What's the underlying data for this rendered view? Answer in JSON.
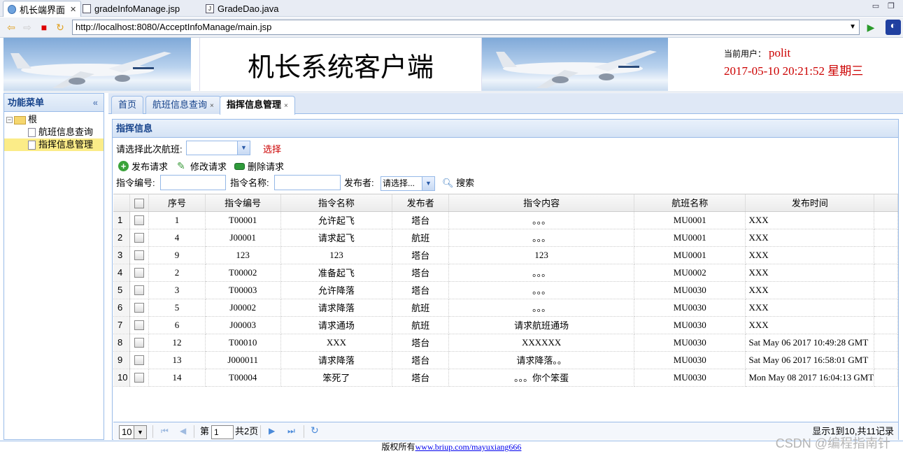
{
  "editor_tabs": [
    {
      "label": "机长端界面",
      "close": "✕"
    },
    {
      "label": "gradeInfoManage.jsp"
    },
    {
      "label": "GradeDao.java"
    }
  ],
  "address": {
    "url": "http://localhost:8080/AcceptInfoManage/main.jsp"
  },
  "header": {
    "system_title": "机长系统客户端",
    "user_label": "当前用户：",
    "user_name": "polit",
    "datetime": "2017-05-10 20:21:52 星期三"
  },
  "menu": {
    "title": "功能菜单",
    "collapse": "«",
    "root": "根",
    "items": [
      "航班信息查询",
      "指挥信息管理"
    ]
  },
  "tabs": [
    {
      "label": "首页"
    },
    {
      "label": "航班信息查询",
      "close": "×"
    },
    {
      "label": "指挥信息管理",
      "close": "×"
    }
  ],
  "panel": {
    "title": "指挥信息",
    "flight_label": "请选择此次航班:",
    "flight_value": "",
    "choose": "选择",
    "btn_publish": "发布请求",
    "btn_edit": "修改请求",
    "btn_delete": "删除请求",
    "code_label": "指令编号:",
    "name_label": "指令名称:",
    "publisher_label": "发布者:",
    "publisher_value": "请选择...",
    "search": "搜索"
  },
  "table": {
    "headers": [
      "序号",
      "指令编号",
      "指令名称",
      "发布者",
      "指令内容",
      "航班名称",
      "发布时间"
    ],
    "rows": [
      [
        "1",
        "1",
        "T00001",
        "允许起飞",
        "塔台",
        "。。。",
        "MU0001",
        "XXX"
      ],
      [
        "2",
        "4",
        "J00001",
        "请求起飞",
        "航班",
        "。。。",
        "MU0001",
        "XXX"
      ],
      [
        "3",
        "9",
        "123",
        "123",
        "塔台",
        "123",
        "MU0001",
        "XXX"
      ],
      [
        "4",
        "2",
        "T00002",
        "准备起飞",
        "塔台",
        "。。。",
        "MU0002",
        "XXX"
      ],
      [
        "5",
        "3",
        "T00003",
        "允许降落",
        "塔台",
        "。。。",
        "MU0030",
        "XXX"
      ],
      [
        "6",
        "5",
        "J00002",
        "请求降落",
        "航班",
        "。。。",
        "MU0030",
        "XXX"
      ],
      [
        "7",
        "6",
        "J00003",
        "请求通场",
        "航班",
        "请求航班通场",
        "MU0030",
        "XXX"
      ],
      [
        "8",
        "12",
        "T00010",
        "XXX",
        "塔台",
        "XXXXXX",
        "MU0030",
        "Sat May 06 2017 10:49:28 GMT"
      ],
      [
        "9",
        "13",
        "J000011",
        "请求降落",
        "塔台",
        "请求降落。。",
        "MU0030",
        "Sat May 06 2017 16:58:01 GMT"
      ],
      [
        "10",
        "14",
        "T00004",
        "笨死了",
        "塔台",
        "。。。你个笨蛋",
        "MU0030",
        "Mon May 08 2017 16:04:13 GMT"
      ]
    ]
  },
  "pager": {
    "page_size": "10",
    "page_prefix": "第",
    "page_num": "1",
    "page_total": "共2页",
    "summary": "显示1到10,共11记录"
  },
  "footer": {
    "text": "版权所有",
    "link": "www.briup.com/mayuxiang666"
  },
  "watermark": "CSDN @编程指南针"
}
